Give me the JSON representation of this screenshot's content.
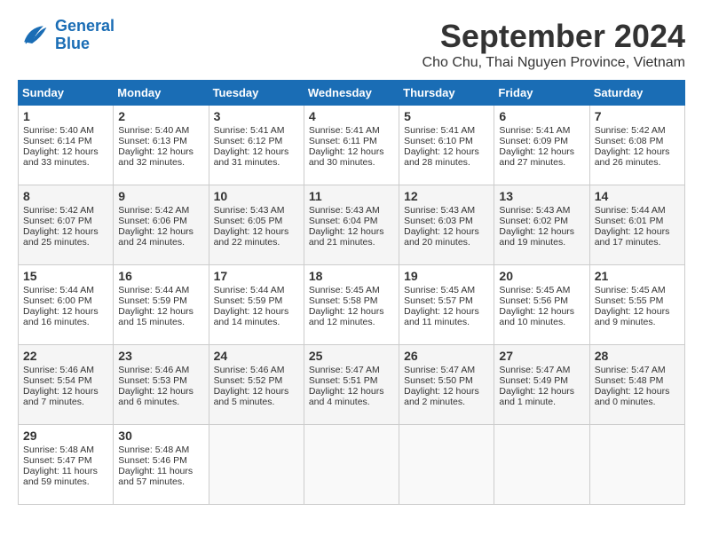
{
  "header": {
    "logo_line1": "General",
    "logo_line2": "Blue",
    "month": "September 2024",
    "location": "Cho Chu, Thai Nguyen Province, Vietnam"
  },
  "weekdays": [
    "Sunday",
    "Monday",
    "Tuesday",
    "Wednesday",
    "Thursday",
    "Friday",
    "Saturday"
  ],
  "weeks": [
    [
      {
        "day": "1",
        "lines": [
          "Sunrise: 5:40 AM",
          "Sunset: 6:14 PM",
          "Daylight: 12 hours",
          "and 33 minutes."
        ]
      },
      {
        "day": "2",
        "lines": [
          "Sunrise: 5:40 AM",
          "Sunset: 6:13 PM",
          "Daylight: 12 hours",
          "and 32 minutes."
        ]
      },
      {
        "day": "3",
        "lines": [
          "Sunrise: 5:41 AM",
          "Sunset: 6:12 PM",
          "Daylight: 12 hours",
          "and 31 minutes."
        ]
      },
      {
        "day": "4",
        "lines": [
          "Sunrise: 5:41 AM",
          "Sunset: 6:11 PM",
          "Daylight: 12 hours",
          "and 30 minutes."
        ]
      },
      {
        "day": "5",
        "lines": [
          "Sunrise: 5:41 AM",
          "Sunset: 6:10 PM",
          "Daylight: 12 hours",
          "and 28 minutes."
        ]
      },
      {
        "day": "6",
        "lines": [
          "Sunrise: 5:41 AM",
          "Sunset: 6:09 PM",
          "Daylight: 12 hours",
          "and 27 minutes."
        ]
      },
      {
        "day": "7",
        "lines": [
          "Sunrise: 5:42 AM",
          "Sunset: 6:08 PM",
          "Daylight: 12 hours",
          "and 26 minutes."
        ]
      }
    ],
    [
      {
        "day": "8",
        "lines": [
          "Sunrise: 5:42 AM",
          "Sunset: 6:07 PM",
          "Daylight: 12 hours",
          "and 25 minutes."
        ]
      },
      {
        "day": "9",
        "lines": [
          "Sunrise: 5:42 AM",
          "Sunset: 6:06 PM",
          "Daylight: 12 hours",
          "and 24 minutes."
        ]
      },
      {
        "day": "10",
        "lines": [
          "Sunrise: 5:43 AM",
          "Sunset: 6:05 PM",
          "Daylight: 12 hours",
          "and 22 minutes."
        ]
      },
      {
        "day": "11",
        "lines": [
          "Sunrise: 5:43 AM",
          "Sunset: 6:04 PM",
          "Daylight: 12 hours",
          "and 21 minutes."
        ]
      },
      {
        "day": "12",
        "lines": [
          "Sunrise: 5:43 AM",
          "Sunset: 6:03 PM",
          "Daylight: 12 hours",
          "and 20 minutes."
        ]
      },
      {
        "day": "13",
        "lines": [
          "Sunrise: 5:43 AM",
          "Sunset: 6:02 PM",
          "Daylight: 12 hours",
          "and 19 minutes."
        ]
      },
      {
        "day": "14",
        "lines": [
          "Sunrise: 5:44 AM",
          "Sunset: 6:01 PM",
          "Daylight: 12 hours",
          "and 17 minutes."
        ]
      }
    ],
    [
      {
        "day": "15",
        "lines": [
          "Sunrise: 5:44 AM",
          "Sunset: 6:00 PM",
          "Daylight: 12 hours",
          "and 16 minutes."
        ]
      },
      {
        "day": "16",
        "lines": [
          "Sunrise: 5:44 AM",
          "Sunset: 5:59 PM",
          "Daylight: 12 hours",
          "and 15 minutes."
        ]
      },
      {
        "day": "17",
        "lines": [
          "Sunrise: 5:44 AM",
          "Sunset: 5:59 PM",
          "Daylight: 12 hours",
          "and 14 minutes."
        ]
      },
      {
        "day": "18",
        "lines": [
          "Sunrise: 5:45 AM",
          "Sunset: 5:58 PM",
          "Daylight: 12 hours",
          "and 12 minutes."
        ]
      },
      {
        "day": "19",
        "lines": [
          "Sunrise: 5:45 AM",
          "Sunset: 5:57 PM",
          "Daylight: 12 hours",
          "and 11 minutes."
        ]
      },
      {
        "day": "20",
        "lines": [
          "Sunrise: 5:45 AM",
          "Sunset: 5:56 PM",
          "Daylight: 12 hours",
          "and 10 minutes."
        ]
      },
      {
        "day": "21",
        "lines": [
          "Sunrise: 5:45 AM",
          "Sunset: 5:55 PM",
          "Daylight: 12 hours",
          "and 9 minutes."
        ]
      }
    ],
    [
      {
        "day": "22",
        "lines": [
          "Sunrise: 5:46 AM",
          "Sunset: 5:54 PM",
          "Daylight: 12 hours",
          "and 7 minutes."
        ]
      },
      {
        "day": "23",
        "lines": [
          "Sunrise: 5:46 AM",
          "Sunset: 5:53 PM",
          "Daylight: 12 hours",
          "and 6 minutes."
        ]
      },
      {
        "day": "24",
        "lines": [
          "Sunrise: 5:46 AM",
          "Sunset: 5:52 PM",
          "Daylight: 12 hours",
          "and 5 minutes."
        ]
      },
      {
        "day": "25",
        "lines": [
          "Sunrise: 5:47 AM",
          "Sunset: 5:51 PM",
          "Daylight: 12 hours",
          "and 4 minutes."
        ]
      },
      {
        "day": "26",
        "lines": [
          "Sunrise: 5:47 AM",
          "Sunset: 5:50 PM",
          "Daylight: 12 hours",
          "and 2 minutes."
        ]
      },
      {
        "day": "27",
        "lines": [
          "Sunrise: 5:47 AM",
          "Sunset: 5:49 PM",
          "Daylight: 12 hours",
          "and 1 minute."
        ]
      },
      {
        "day": "28",
        "lines": [
          "Sunrise: 5:47 AM",
          "Sunset: 5:48 PM",
          "Daylight: 12 hours",
          "and 0 minutes."
        ]
      }
    ],
    [
      {
        "day": "29",
        "lines": [
          "Sunrise: 5:48 AM",
          "Sunset: 5:47 PM",
          "Daylight: 11 hours",
          "and 59 minutes."
        ]
      },
      {
        "day": "30",
        "lines": [
          "Sunrise: 5:48 AM",
          "Sunset: 5:46 PM",
          "Daylight: 11 hours",
          "and 57 minutes."
        ]
      },
      null,
      null,
      null,
      null,
      null
    ]
  ]
}
